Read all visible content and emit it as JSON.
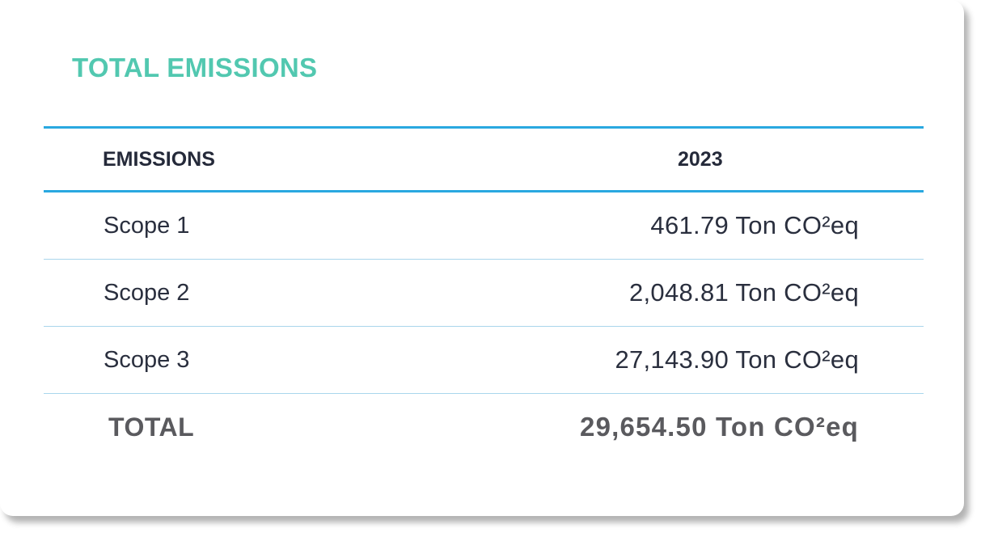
{
  "title": "TOTAL EMISSIONS",
  "table": {
    "headers": {
      "label": "EMISSIONS",
      "year": "2023"
    },
    "rows": [
      {
        "label": "Scope 1",
        "value": "461.79 Ton CO²eq"
      },
      {
        "label": "Scope 2",
        "value": "2,048.81 Ton CO²eq"
      },
      {
        "label": "Scope 3",
        "value": "27,143.90 Ton CO²eq"
      }
    ],
    "total": {
      "label": "TOTAL",
      "value": "29,654.50 Ton CO²eq"
    }
  },
  "colors": {
    "title": "#52c8b0",
    "rule": "#29a8e0",
    "divider": "#a9d6ec",
    "text": "#2a2f3e",
    "total_text": "#5a5a5e"
  }
}
